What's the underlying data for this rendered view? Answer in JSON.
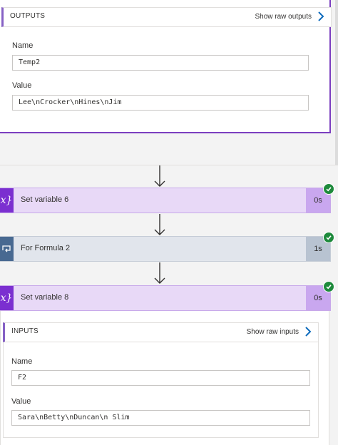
{
  "outputs": {
    "title": "OUTPUTS",
    "raw_link": "Show raw outputs",
    "fields": [
      {
        "label": "Name",
        "value": "Temp2"
      },
      {
        "label": "Value",
        "value": "Lee\\nCrocker\\nHines\\nJim"
      }
    ]
  },
  "steps": [
    {
      "title": "Set variable 6",
      "duration": "0s",
      "icon": "variable-icon",
      "status": "succeeded"
    },
    {
      "title": "For Formula 2",
      "duration": "1s",
      "icon": "loop-icon",
      "status": "succeeded"
    },
    {
      "title": "Set variable 8",
      "duration": "0s",
      "icon": "variable-icon",
      "status": "succeeded"
    }
  ],
  "inputs": {
    "title": "INPUTS",
    "raw_link": "Show raw inputs",
    "fields": [
      {
        "label": "Name",
        "value": "F2"
      },
      {
        "label": "Value",
        "value": "Sara\\nBetty\\nDuncan\\n Slim"
      }
    ]
  },
  "icons": {
    "variable_glyph": "x}",
    "success": "check-circle-icon",
    "chevron": "chevron-right-icon",
    "connector": "arrow-down-icon"
  },
  "colors": {
    "variable_accent": "#7b2fd0",
    "variable_bg": "#e8d9f7",
    "loop_accent": "#486991",
    "loop_bg": "#e1e5ec",
    "success": "#1e8a3c",
    "link_chevron": "#0f6cbd",
    "selected_border": "#7b3fbf"
  }
}
